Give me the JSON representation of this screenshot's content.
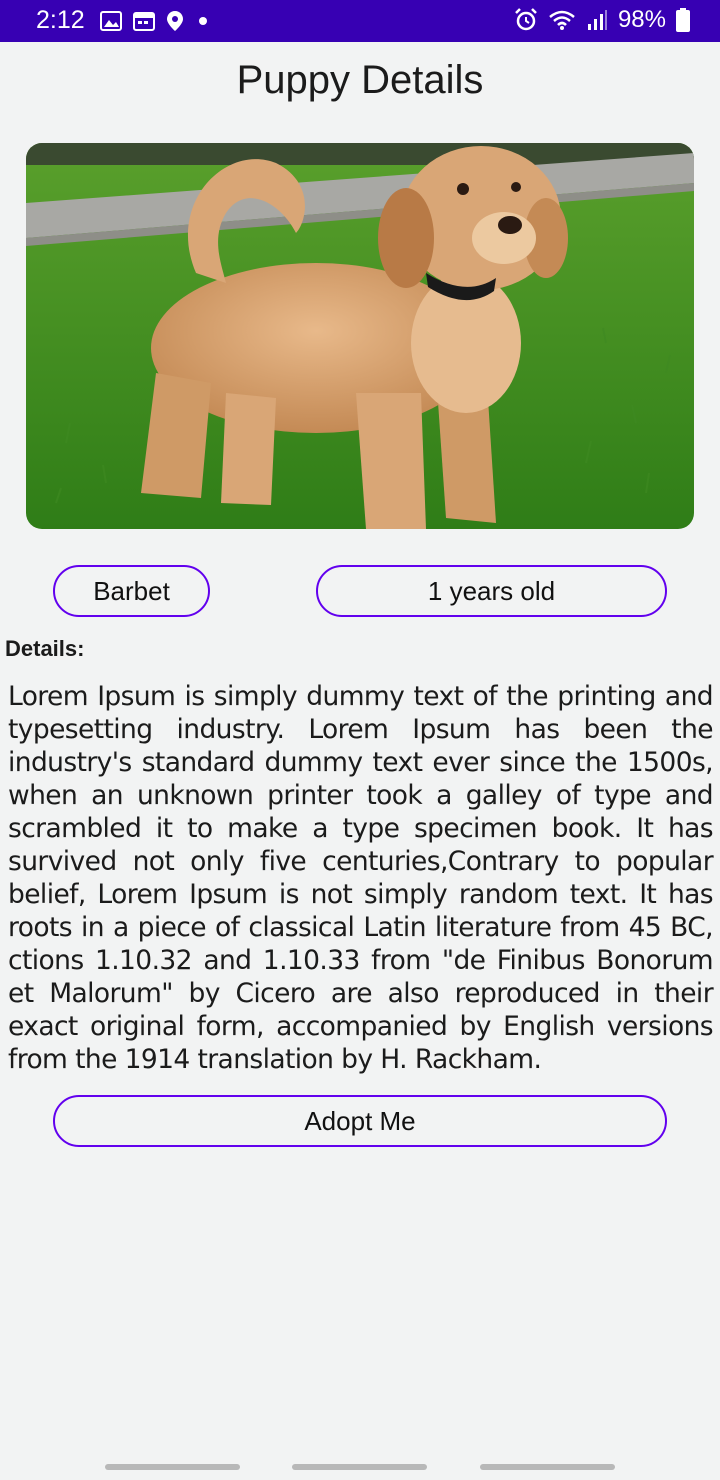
{
  "status_bar": {
    "time": "2:12",
    "battery": "98%",
    "icons": [
      "image-icon",
      "calendar-icon",
      "location-icon",
      "dot-icon",
      "alarm-icon",
      "wifi-icon",
      "signal-icon",
      "battery-icon"
    ]
  },
  "page": {
    "title": "Puppy Details"
  },
  "puppy": {
    "breed": "Barbet",
    "age": "1 years old",
    "details_label": "Details:",
    "description": "Lorem Ipsum is simply dummy text of the printing and typesetting industry. Lorem Ipsum has been the industry's standard dummy text ever since the 1500s, when an unknown printer took a galley of type and scrambled it to make a type specimen book. It has survived not only five centuries,Contrary to popular belief, Lorem Ipsum is not simply random text. It has roots in a piece of classical Latin literature from 45 BC, ctions 1.10.32 and 1.10.33 from \"de Finibus Bonorum et Malorum\" by Cicero are also reproduced in their exact original form, accompanied by English versions from the 1914 translation by H. Rackham."
  },
  "actions": {
    "adopt_label": "Adopt Me"
  },
  "colors": {
    "status_bar": "#3700b3",
    "accent": "#6200ee",
    "background": "#f2f3f3"
  }
}
